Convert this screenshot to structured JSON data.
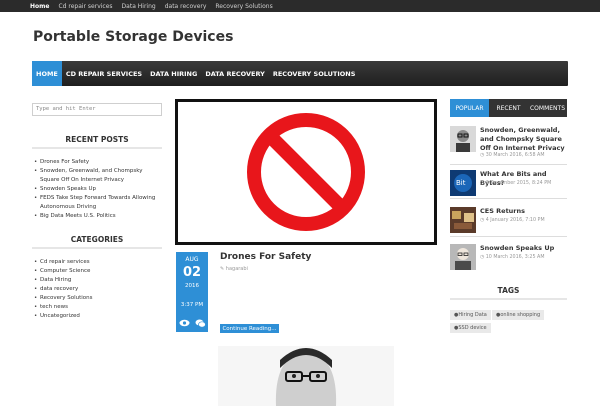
{
  "topbar": {
    "items": [
      "Home",
      "Cd repair services",
      "Data Hiring",
      "data recovery",
      "Recovery Solutions"
    ]
  },
  "site": {
    "title": "Portable Storage Devices"
  },
  "mainnav": {
    "items": [
      "HOME",
      "CD REPAIR SERVICES",
      "DATA HIRING",
      "DATA RECOVERY",
      "RECOVERY SOLUTIONS"
    ]
  },
  "search": {
    "placeholder": "Type and hit Enter"
  },
  "recent_posts": {
    "title": "RECENT POSTS",
    "items": [
      "Drones For Safety",
      "Snowden, Greenwald, and Chompsky Square Off On Internet Privacy",
      "Snowden Speaks Up",
      "FEDS Take Step Forward Towards Allowing Autonomous Driving",
      "Big Data Meets U.S. Politics"
    ]
  },
  "categories": {
    "title": "CATEGORIES",
    "items": [
      "Cd repair services",
      "Computer Science",
      "Data Hiring",
      "data recovery",
      "Recovery Solutions",
      "tech news",
      "Uncategorized"
    ]
  },
  "post": {
    "month": "AUG",
    "day": "02",
    "year": "2016",
    "time": "3:37 PM",
    "title": "Drones For Safety",
    "author": "hagarabi",
    "continue": "Continue Reading..."
  },
  "tabs": [
    "POPULAR",
    "RECENT",
    "COMMENTS"
  ],
  "popular": [
    {
      "title": "Snowden, Greenwald, and Chompsky Square Off On Internet Privacy",
      "date": "30 March 2016, 6:58 AM"
    },
    {
      "title": "What Are Bits and Bytes?",
      "date": "3 December 2015, 8:24 PM"
    },
    {
      "title": "CES Returns",
      "date": "4 January 2016, 7:10 PM"
    },
    {
      "title": "Snowden Speaks Up",
      "date": "10 March 2016, 3:25 AM"
    }
  ],
  "tags": {
    "title": "TAGS",
    "items": [
      "Hiring Data",
      "online shopping",
      "SSD device"
    ]
  },
  "colors": {
    "accent": "#2e8fd6",
    "nav_dark": "#2b2b2b",
    "stop_red": "#e8161b"
  },
  "icons": {
    "eye": "eye-icon",
    "comments": "comments-icon",
    "pencil": "pencil-icon",
    "clock": "clock-icon",
    "tag": "tag-icon"
  }
}
